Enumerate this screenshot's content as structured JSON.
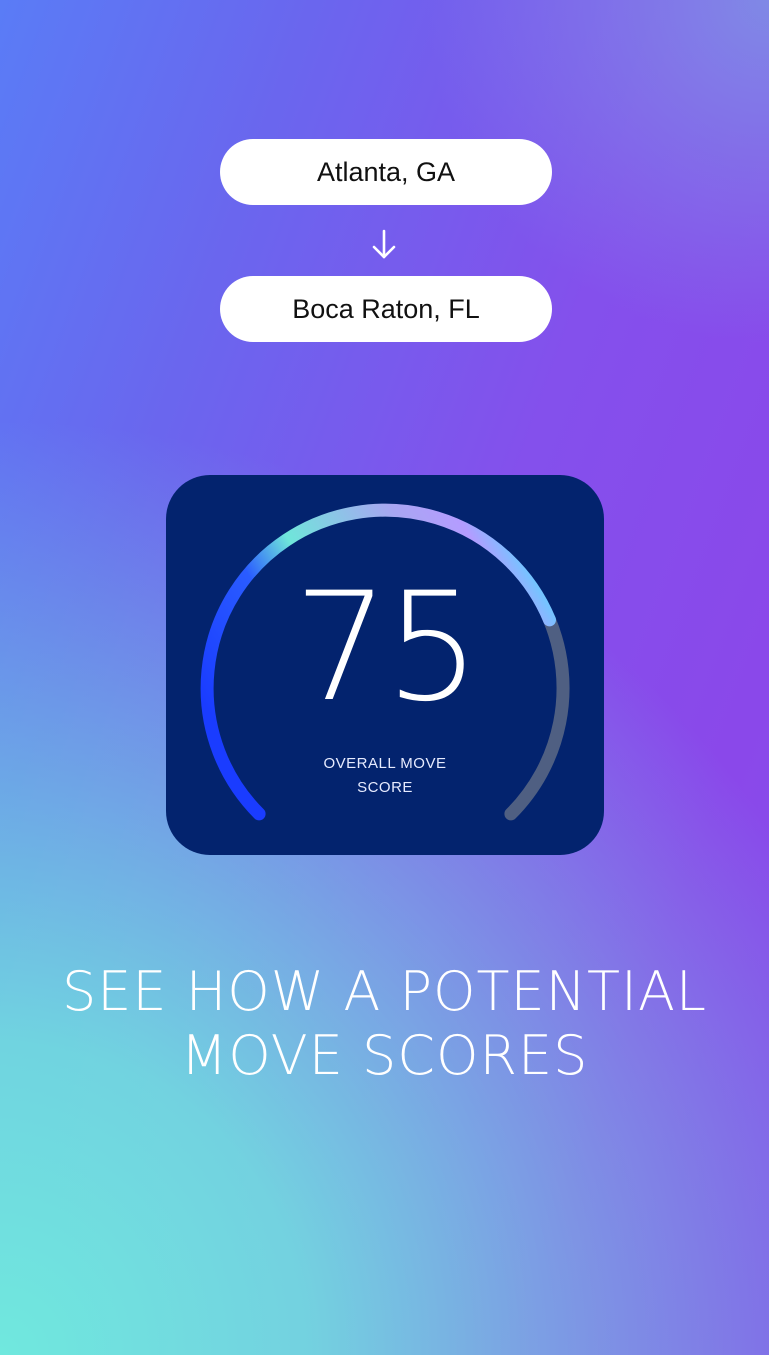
{
  "route": {
    "origin": "Atlanta, GA",
    "destination": "Boca Raton, FL",
    "direction_icon": "arrow-down-icon"
  },
  "score_card": {
    "value": "75",
    "label": "OVERALL MOVE SCORE",
    "max": 100,
    "gauge_fill_fraction": 0.75,
    "colors": {
      "card_background": "#03236e",
      "gauge_track": "#4f5f82",
      "gauge_start": "#1a3cff",
      "gauge_mid": "#6fe6da",
      "gauge_end": "#b49cff",
      "gauge_tip": "#6fc8ff"
    }
  },
  "headline": {
    "line1": "SEE HOW A POTENTIAL",
    "line2": "MOVE SCORES"
  },
  "colors": {
    "background_teal": "#70e8de",
    "background_purple": "#8a48ea",
    "background_blue": "#5a7cf6",
    "pill_background": "#ffffff",
    "text_dark": "#111111",
    "text_light": "#ffffff"
  }
}
